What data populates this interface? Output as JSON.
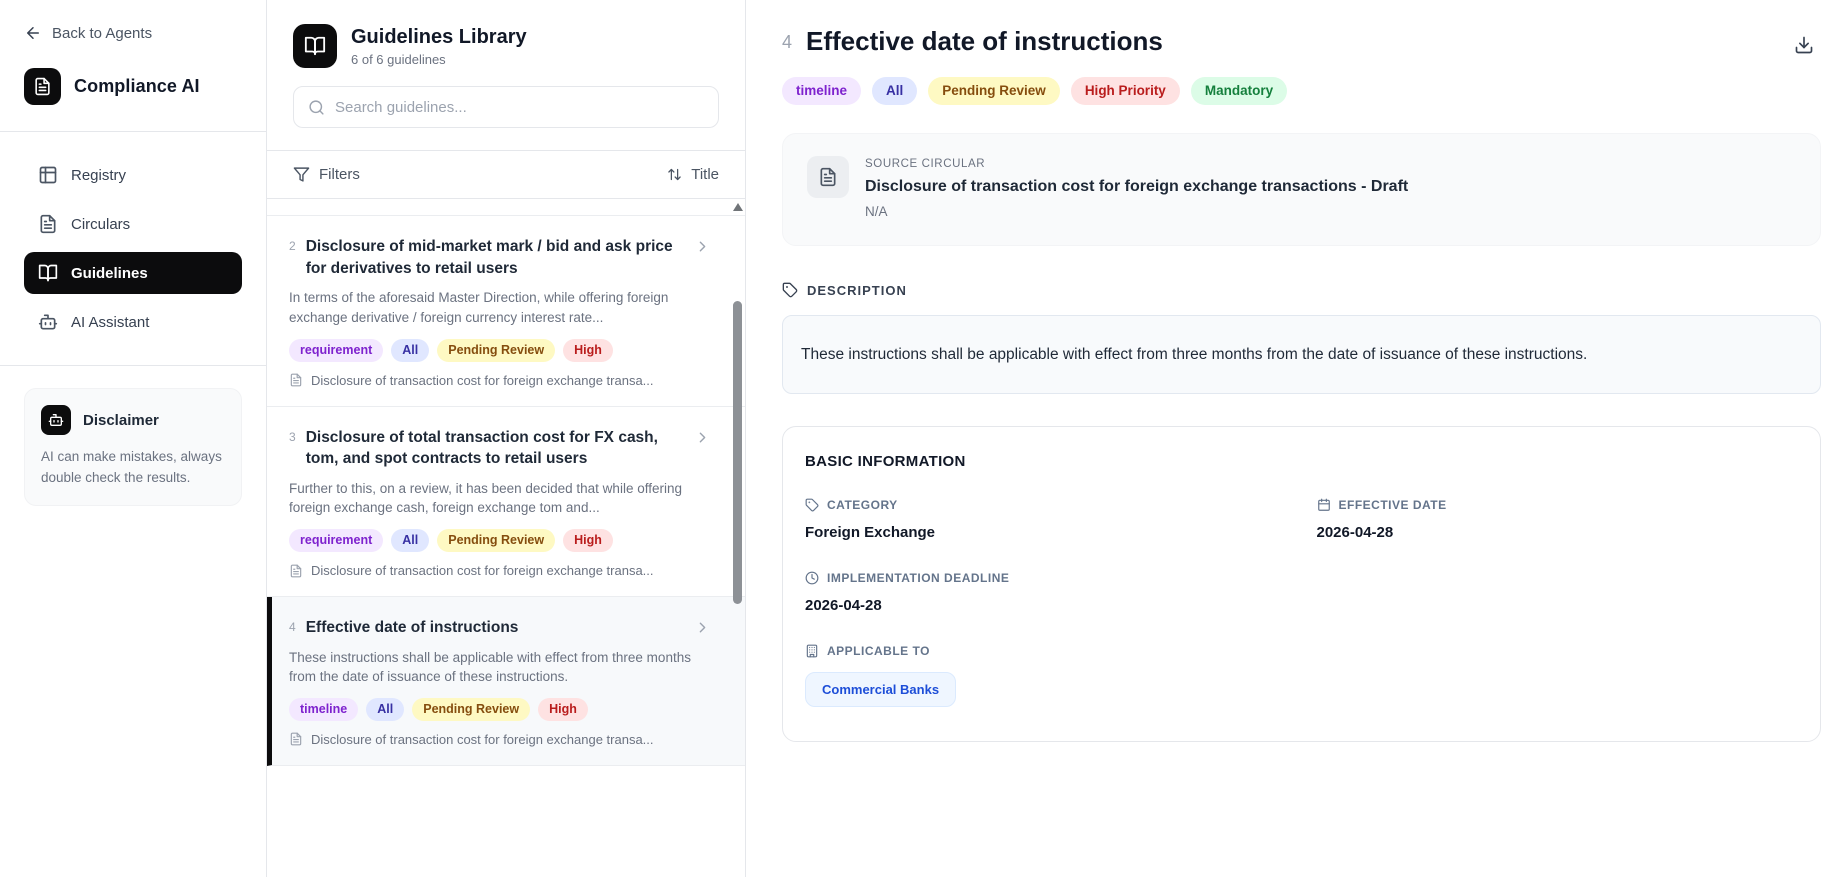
{
  "sidebar": {
    "back_label": "Back to Agents",
    "brand": "Compliance AI",
    "nav": [
      {
        "label": "Registry",
        "icon": "table",
        "active": false
      },
      {
        "label": "Circulars",
        "icon": "file-text",
        "active": false
      },
      {
        "label": "Guidelines",
        "icon": "book-open",
        "active": true
      },
      {
        "label": "AI Assistant",
        "icon": "bot",
        "active": false
      }
    ],
    "disclaimer": {
      "title": "Disclaimer",
      "text": "AI can make mistakes, always double check the results."
    }
  },
  "library": {
    "title": "Guidelines Library",
    "count": "6 of 6 guidelines",
    "search_placeholder": "Search guidelines...",
    "filters_label": "Filters",
    "sort_label": "Title",
    "items": [
      {
        "num": "2",
        "title": "Disclosure of mid-market mark / bid and ask price for derivatives to retail users",
        "desc": "In terms of the aforesaid Master Direction, while offering foreign exchange derivative / foreign currency interest rate...",
        "tags": [
          {
            "label": "requirement",
            "type": "purple"
          },
          {
            "label": "All",
            "type": "indigo"
          },
          {
            "label": "Pending Review",
            "type": "yellow"
          },
          {
            "label": "High",
            "type": "red"
          }
        ],
        "source": "Disclosure of transaction cost for foreign exchange transa...",
        "selected": false
      },
      {
        "num": "3",
        "title": "Disclosure of total transaction cost for FX cash, tom, and spot contracts to retail users",
        "desc": "Further to this, on a review, it has been decided that while offering foreign exchange cash, foreign exchange tom and...",
        "tags": [
          {
            "label": "requirement",
            "type": "purple"
          },
          {
            "label": "All",
            "type": "indigo"
          },
          {
            "label": "Pending Review",
            "type": "yellow"
          },
          {
            "label": "High",
            "type": "red"
          }
        ],
        "source": "Disclosure of transaction cost for foreign exchange transa...",
        "selected": false
      },
      {
        "num": "4",
        "title": "Effective date of instructions",
        "desc": "These instructions shall be applicable with effect from three months from the date of issuance of these instructions.",
        "tags": [
          {
            "label": "timeline",
            "type": "purple"
          },
          {
            "label": "All",
            "type": "indigo"
          },
          {
            "label": "Pending Review",
            "type": "yellow"
          },
          {
            "label": "High",
            "type": "red"
          }
        ],
        "source": "Disclosure of transaction cost for foreign exchange transa...",
        "selected": true
      }
    ]
  },
  "detail": {
    "num": "4",
    "title": "Effective date of instructions",
    "tags": [
      {
        "label": "timeline",
        "type": "purple"
      },
      {
        "label": "All",
        "type": "indigo"
      },
      {
        "label": "Pending Review",
        "type": "yellow"
      },
      {
        "label": "High Priority",
        "type": "red"
      },
      {
        "label": "Mandatory",
        "type": "green"
      }
    ],
    "source": {
      "label": "SOURCE CIRCULAR",
      "title": "Disclosure of transaction cost for foreign exchange transactions - Draft",
      "sub": "N/A"
    },
    "description": {
      "heading": "DESCRIPTION",
      "text": "These instructions shall be applicable with effect from three months from the date of issuance of these instructions."
    },
    "basic": {
      "heading": "BASIC INFORMATION",
      "fields": [
        {
          "key": "category",
          "label": "CATEGORY",
          "icon": "tag",
          "value": "Foreign Exchange",
          "col": 0,
          "pill": false
        },
        {
          "key": "effective-date",
          "label": "EFFECTIVE DATE",
          "icon": "calendar",
          "value": "2026-04-28",
          "col": 1,
          "pill": false
        },
        {
          "key": "implementation-deadline",
          "label": "IMPLEMENTATION DEADLINE",
          "icon": "clock",
          "value": "2026-04-28",
          "col": 0,
          "pill": false
        },
        {
          "key": "applicable-to",
          "label": "APPLICABLE TO",
          "icon": "building",
          "value": "Commercial Banks",
          "col": 0,
          "pill": true
        }
      ]
    }
  },
  "colors": {
    "accent_black": "#0c0c0d",
    "border": "#e5e7eb",
    "tag_purple_bg": "#f3e8ff",
    "tag_purple_fg": "#7e22ce",
    "tag_indigo_bg": "#e0e7ff",
    "tag_indigo_fg": "#3730a3",
    "tag_yellow_bg": "#fef9c3",
    "tag_yellow_fg": "#854d0e",
    "tag_red_bg": "#fee2e2",
    "tag_red_fg": "#b91c1c",
    "tag_green_bg": "#dcfce7",
    "tag_green_fg": "#15803d",
    "pill_blue_bg": "#eff6ff",
    "pill_blue_fg": "#1d4ed8"
  }
}
